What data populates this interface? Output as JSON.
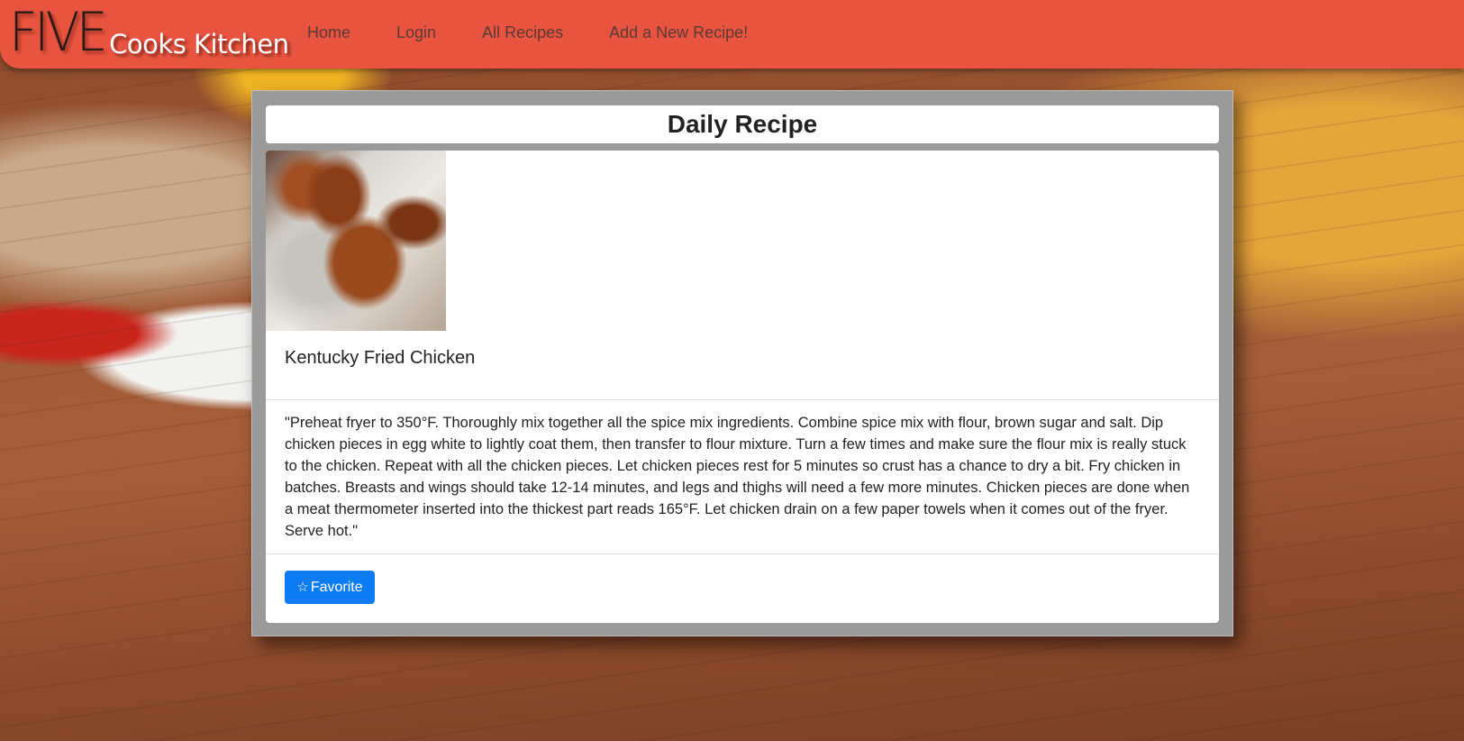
{
  "brand": {
    "big": "FIVE",
    "small": "Cooks Kitchen"
  },
  "nav": {
    "items": [
      {
        "label": "Home"
      },
      {
        "label": "Login"
      },
      {
        "label": "All Recipes"
      },
      {
        "label": "Add a New Recipe!"
      }
    ]
  },
  "main": {
    "heading": "Daily Recipe",
    "recipe": {
      "image_icon": "fried-chicken-photo",
      "title": "Kentucky Fried Chicken",
      "body": "\"Preheat fryer to 350°F. Thoroughly mix together all the spice mix ingredients. Combine spice mix with flour, brown sugar and salt. Dip chicken pieces in egg white to lightly coat them, then transfer to flour mixture. Turn a few times and make sure the flour mix is really stuck to the chicken. Repeat with all the chicken pieces. Let chicken pieces rest for 5 minutes so crust has a chance to dry a bit. Fry chicken in batches. Breasts and wings should take 12-14 minutes, and legs and thighs will need a few more minutes. Chicken pieces are done when a meat thermometer inserted into the thickest part reads 165°F. Let chicken drain on a few paper towels when it comes out of the fryer. Serve hot.\"",
      "favorite_label": "Favorite",
      "favorite_icon": "star-outline-icon"
    }
  },
  "colors": {
    "navbar": "#e95440",
    "button": "#0d7cf2"
  }
}
